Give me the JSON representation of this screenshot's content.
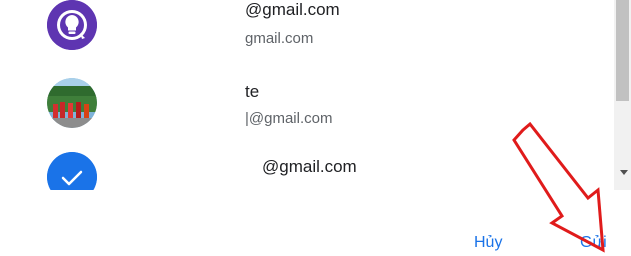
{
  "contacts": [
    {
      "name": "@gmail.com",
      "email": "gmail.com",
      "avatar_icon": "lightbulb-icon",
      "avatar_color": "#5e35b1"
    },
    {
      "name": "te",
      "email": "|@gmail.com",
      "avatar_icon": "photo-avatar",
      "avatar_color": "#3b6b3a"
    },
    {
      "name": "@gmail.com",
      "email": "",
      "avatar_icon": "check-icon",
      "avatar_color": "#1a73e8",
      "selected": true
    }
  ],
  "actions": {
    "cancel_label": "Hủy",
    "send_label": "Gửi"
  },
  "colors": {
    "accent": "#1a73e8",
    "arrow": "#e01b1b"
  }
}
